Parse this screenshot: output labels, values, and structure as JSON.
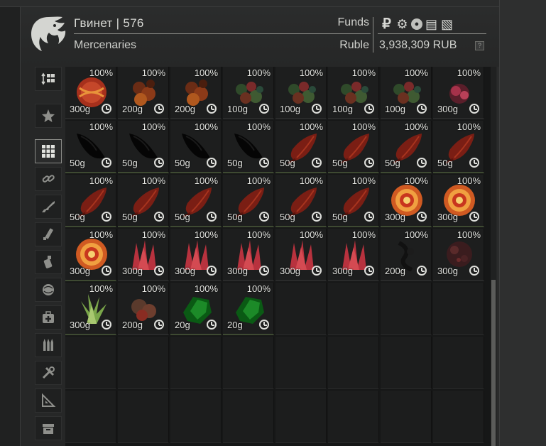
{
  "trader": {
    "name": "Гвинет | 576",
    "subtitle": "Mercenaries",
    "funds_label": "Funds",
    "currency_label": "Ruble",
    "balance": "3,938,309 RUB",
    "help": "?",
    "currency_icons": [
      "ruble-icon",
      "gear-coin-icon",
      "round-coin-icon",
      "stack-icon",
      "ticket-icon"
    ]
  },
  "sidebar": {
    "items": [
      "sort-icon",
      "favorite-star-icon",
      "grid-all-icon",
      "chain-link-icon",
      "rifle-icon",
      "suppressor-icon",
      "grenade-icon",
      "helmet-ball-icon",
      "medkit-icon",
      "ammo-icon",
      "tools-icon",
      "ruler-triangle-icon",
      "container-box-icon"
    ],
    "active": "grid-all-icon"
  },
  "items": [
    {
      "pct": "100%",
      "weight": "300g",
      "kind": "orb-red"
    },
    {
      "pct": "100%",
      "weight": "200g",
      "kind": "lumpy-orange"
    },
    {
      "pct": "100%",
      "weight": "200g",
      "kind": "lumpy-orange"
    },
    {
      "pct": "100%",
      "weight": "100g",
      "kind": "cluster-green"
    },
    {
      "pct": "100%",
      "weight": "100g",
      "kind": "cluster-green"
    },
    {
      "pct": "100%",
      "weight": "100g",
      "kind": "cluster-green"
    },
    {
      "pct": "100%",
      "weight": "100g",
      "kind": "cluster-green"
    },
    {
      "pct": "100%",
      "weight": "300g",
      "kind": "pink-flower"
    },
    {
      "pct": "100%",
      "weight": "50g",
      "kind": "black-shard"
    },
    {
      "pct": "100%",
      "weight": "50g",
      "kind": "black-shard"
    },
    {
      "pct": "100%",
      "weight": "50g",
      "kind": "black-shard"
    },
    {
      "pct": "100%",
      "weight": "50g",
      "kind": "black-shard"
    },
    {
      "pct": "100%",
      "weight": "50g",
      "kind": "red-leaf"
    },
    {
      "pct": "100%",
      "weight": "50g",
      "kind": "red-leaf"
    },
    {
      "pct": "100%",
      "weight": "50g",
      "kind": "red-leaf"
    },
    {
      "pct": "100%",
      "weight": "50g",
      "kind": "red-leaf"
    },
    {
      "pct": "100%",
      "weight": "50g",
      "kind": "red-leaf"
    },
    {
      "pct": "100%",
      "weight": "50g",
      "kind": "red-leaf"
    },
    {
      "pct": "100%",
      "weight": "50g",
      "kind": "red-leaf"
    },
    {
      "pct": "100%",
      "weight": "50g",
      "kind": "red-leaf"
    },
    {
      "pct": "100%",
      "weight": "50g",
      "kind": "red-leaf"
    },
    {
      "pct": "100%",
      "weight": "50g",
      "kind": "red-leaf"
    },
    {
      "pct": "100%",
      "weight": "300g",
      "kind": "spiral"
    },
    {
      "pct": "100%",
      "weight": "300g",
      "kind": "spiral"
    },
    {
      "pct": "100%",
      "weight": "300g",
      "kind": "spiral"
    },
    {
      "pct": "100%",
      "weight": "300g",
      "kind": "red-crystal"
    },
    {
      "pct": "100%",
      "weight": "300g",
      "kind": "red-crystal"
    },
    {
      "pct": "100%",
      "weight": "300g",
      "kind": "red-crystal"
    },
    {
      "pct": "100%",
      "weight": "300g",
      "kind": "red-crystal"
    },
    {
      "pct": "100%",
      "weight": "300g",
      "kind": "red-crystal"
    },
    {
      "pct": "100%",
      "weight": "200g",
      "kind": "dark-vine"
    },
    {
      "pct": "100%",
      "weight": "300g",
      "kind": "dark-rock"
    },
    {
      "pct": "100%",
      "weight": "300g",
      "kind": "green-burst"
    },
    {
      "pct": "100%",
      "weight": "200g",
      "kind": "lumpy-brown"
    },
    {
      "pct": "100%",
      "weight": "20g",
      "kind": "green-gem"
    },
    {
      "pct": "100%",
      "weight": "20g",
      "kind": "green-gem"
    }
  ],
  "grid": {
    "columns": 8,
    "rows": 7
  },
  "colors": {
    "accent": "#8d8e8a",
    "panel": "#262727",
    "cell": "#1d1e1e"
  }
}
